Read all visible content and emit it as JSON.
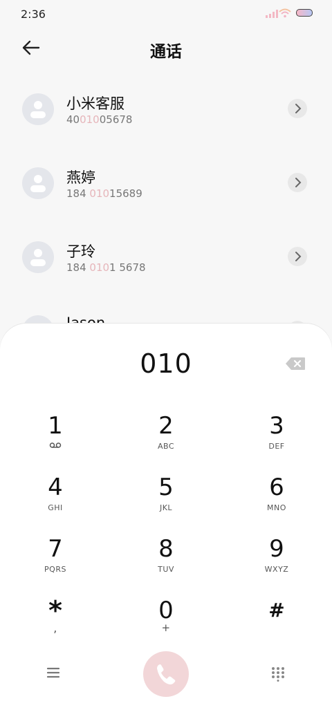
{
  "status": {
    "time": "2:36"
  },
  "header": {
    "title": "通话"
  },
  "contacts": [
    {
      "name": "小米客服",
      "num_pre": "40",
      "num_hl": "010",
      "num_post": "05678"
    },
    {
      "name": "燕婷",
      "num_pre": "184 ",
      "num_hl": "010",
      "num_post": "15689"
    },
    {
      "name": "子玲",
      "num_pre": "184 ",
      "num_hl": "010",
      "num_post": "1 5678"
    },
    {
      "name": "Jason"
    }
  ],
  "dialer": {
    "input": "010",
    "keys": [
      {
        "digit": "1",
        "letters": ""
      },
      {
        "digit": "2",
        "letters": "ABC"
      },
      {
        "digit": "3",
        "letters": "DEF"
      },
      {
        "digit": "4",
        "letters": "GHI"
      },
      {
        "digit": "5",
        "letters": "JKL"
      },
      {
        "digit": "6",
        "letters": "MNO"
      },
      {
        "digit": "7",
        "letters": "PQRS"
      },
      {
        "digit": "8",
        "letters": "TUV"
      },
      {
        "digit": "9",
        "letters": "WXYZ"
      },
      {
        "digit": "*",
        "letters": ","
      },
      {
        "digit": "0",
        "letters": "+"
      },
      {
        "digit": "#",
        "letters": ""
      }
    ]
  },
  "colors": {
    "highlight": "#e6b5ba",
    "call_button": "#f2d6d8",
    "avatar_bg": "#e4e6eb"
  }
}
